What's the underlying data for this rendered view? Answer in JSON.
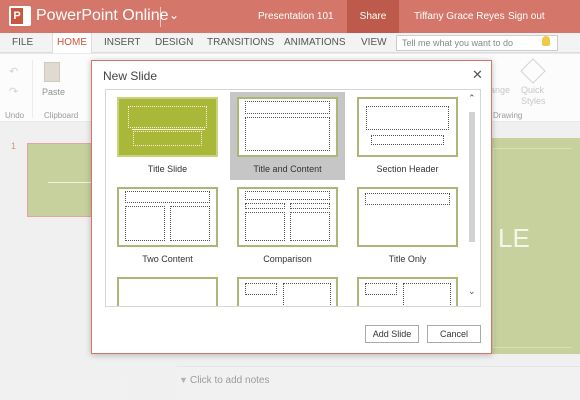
{
  "titlebar": {
    "app_name": "PowerPoint Online",
    "document_name": "Presentation 101",
    "share_label": "Share",
    "user_name": "Tiffany Grace Reyes",
    "sign_out_label": "Sign out",
    "accent_color": "#d4776a"
  },
  "tabs": [
    "FILE",
    "HOME",
    "INSERT",
    "DESIGN",
    "TRANSITIONS",
    "ANIMATIONS",
    "VIEW"
  ],
  "active_tab": "HOME",
  "tell_me_placeholder": "Tell me what you want to do",
  "ribbon": {
    "paste_label": "Paste",
    "undo_group": "Undo",
    "clipboard_group": "Clipboard",
    "drawing_group": "Drawing",
    "arrange_label": "ange",
    "quick_styles_line1": "Quick",
    "quick_styles_line2": "Styles"
  },
  "thumbnail_number": "1",
  "slide_partial_letter": "LE",
  "notes_placeholder": "Click to add notes",
  "dialog": {
    "title": "New Slide",
    "layouts": [
      {
        "name": "Title Slide",
        "selected": false
      },
      {
        "name": "Title and Content",
        "selected": true
      },
      {
        "name": "Section Header",
        "selected": false
      },
      {
        "name": "Two Content",
        "selected": false
      },
      {
        "name": "Comparison",
        "selected": false
      },
      {
        "name": "Title Only",
        "selected": false
      }
    ],
    "add_button": "Add Slide",
    "cancel_button": "Cancel"
  }
}
